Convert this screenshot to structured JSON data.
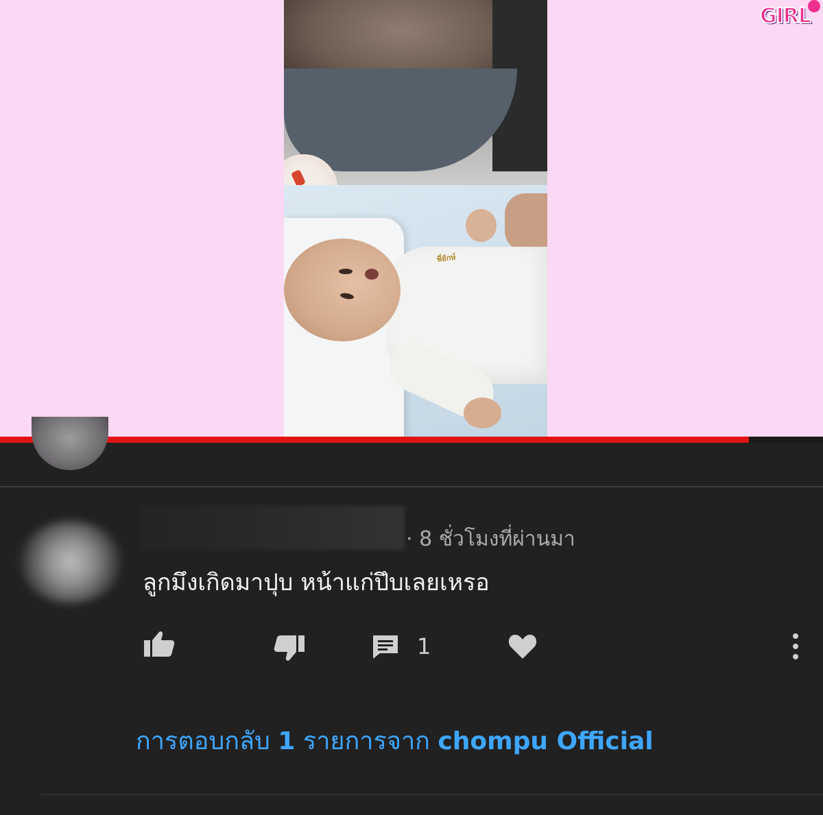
{
  "video": {
    "watermark_text": "GIRL",
    "baby_shirt_text": "พี่ยักษ์",
    "progress": 0.91,
    "colors": {
      "background": "#fbd8f4",
      "progress": "#e11414"
    }
  },
  "comment": {
    "timestamp": "· 8 ชั่วโมงที่ผ่านมา",
    "text": "ลูกมึงเกิดมาปุบ หน้าแก่ปึบเลยเหรอ",
    "reply_count": "1",
    "actions": {
      "like_icon": "thumbs-up-icon",
      "dislike_icon": "thumbs-down-icon",
      "reply_icon": "comment-icon",
      "heart_icon": "heart-icon",
      "menu_icon": "more-vertical-icon"
    }
  },
  "replies": {
    "prefix": "การตอบกลับ ",
    "count": "1",
    "middle": " รายการจาก ",
    "channel": "chompu Official"
  },
  "theme": {
    "panel_background": "#212121",
    "link_color": "#3ea6ff",
    "text_color": "#f1f1f1",
    "muted_color": "#aaaaaa"
  }
}
